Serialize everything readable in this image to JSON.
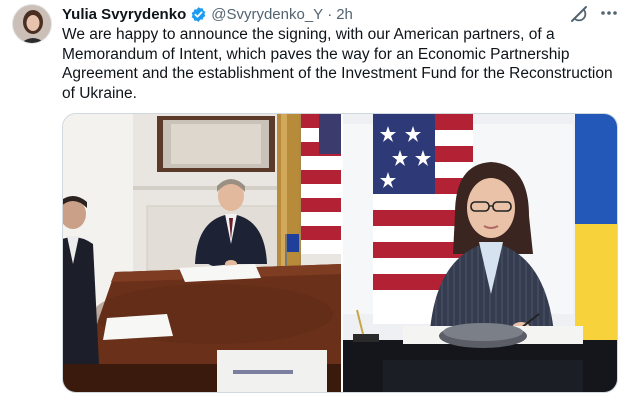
{
  "author": {
    "name": "Yulia Svyrydenko",
    "handle": "@Svyrydenko_Y",
    "separator": "·",
    "time": "2h"
  },
  "tweet": {
    "text": "We are happy to announce the signing, with our American partners, of a Memorandum of Intent, which paves the way for an Economic Partnership Agreement and the establishment of the Investment Fund for the Reconstruction of Ukraine."
  },
  "icons": {
    "verified": "verified-badge-icon",
    "grok": "grok-icon",
    "more": "more-options-icon"
  },
  "colors": {
    "verified_blue": "#1d9bf0",
    "muted_text": "#536471"
  },
  "media": {
    "photo_count": 2
  }
}
